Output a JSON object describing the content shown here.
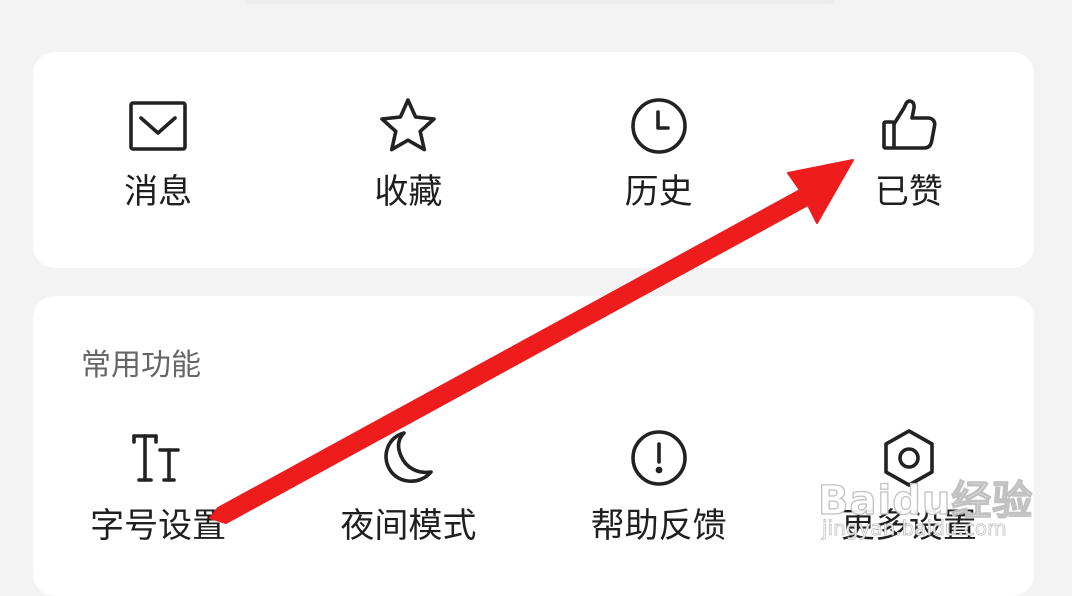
{
  "quick_actions": [
    {
      "label": "消息",
      "icon": "mail-icon"
    },
    {
      "label": "收藏",
      "icon": "star-icon"
    },
    {
      "label": "历史",
      "icon": "clock-icon"
    },
    {
      "label": "已赞",
      "icon": "thumbs-up-icon"
    }
  ],
  "common_functions": {
    "title": "常用功能",
    "items": [
      {
        "label": "字号设置",
        "icon": "font-size-icon"
      },
      {
        "label": "夜间模式",
        "icon": "moon-icon"
      },
      {
        "label": "帮助反馈",
        "icon": "exclamation-circle-icon"
      },
      {
        "label": "更多设置",
        "icon": "hexagon-settings-icon"
      }
    ]
  },
  "watermark": {
    "brand": "Baidu经验",
    "domain": "jingyan.baidu.com"
  },
  "colors": {
    "background": "#f3f3f3",
    "card": "#ffffff",
    "text": "#1f1f1f",
    "section_title": "#666666",
    "icon_stroke": "#222222",
    "annotation_arrow": "#ee1c1c"
  }
}
